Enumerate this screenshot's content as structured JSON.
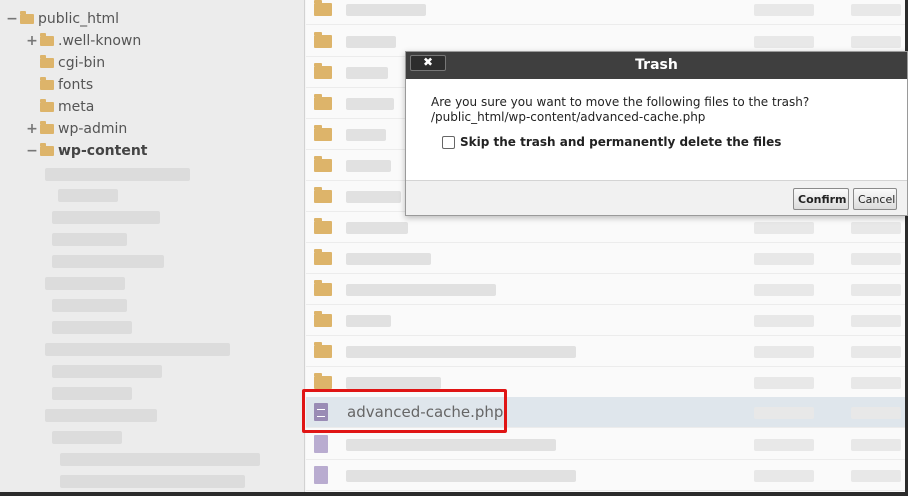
{
  "tree": {
    "items": [
      {
        "label": "public_html",
        "toggle": "−",
        "bold": false
      },
      {
        "label": ".well-known",
        "toggle": "+",
        "bold": false
      },
      {
        "label": "cgi-bin",
        "toggle": "",
        "bold": false
      },
      {
        "label": "fonts",
        "toggle": "",
        "bold": false
      },
      {
        "label": "meta",
        "toggle": "",
        "bold": false
      },
      {
        "label": "wp-admin",
        "toggle": "+",
        "bold": false
      },
      {
        "label": "wp-content",
        "toggle": "−",
        "bold": true
      }
    ]
  },
  "file_list": {
    "selected_file": "advanced-cache.php",
    "selected_icon": "php-file-icon",
    "folder_icon": "folder-icon"
  },
  "dialog": {
    "title": "Trash",
    "close_symbol": "✖",
    "message": "Are you sure you want to move the following files to the trash?",
    "file_path": "/public_html/wp-content/advanced-cache.php",
    "skip_label": "Skip the trash and permanently delete the files",
    "skip_checked": false,
    "confirm_label": "Confirm",
    "cancel_label": "Cancel"
  },
  "colors": {
    "highlight": "#e01515",
    "folder": "#ddb46a",
    "dialog_header": "#3f3f3f"
  }
}
